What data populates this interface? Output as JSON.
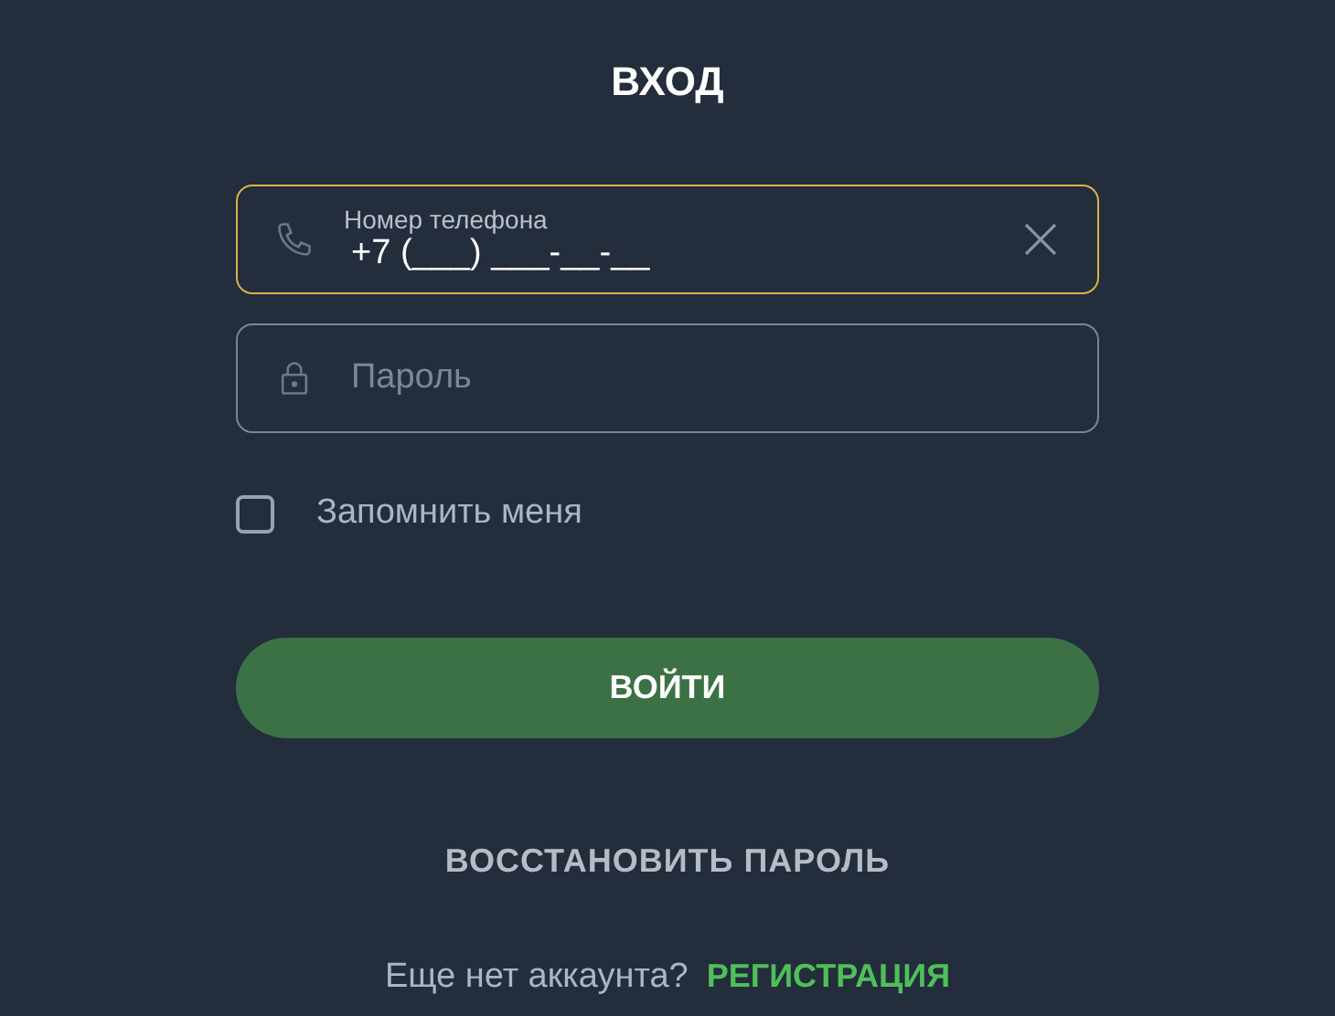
{
  "title": "ВХОД",
  "fields": [
    {
      "kind": "phone",
      "label": "Номер телефона",
      "value": "+7 (___) ___-__-__",
      "focused": true
    },
    {
      "kind": "password",
      "placeholder": "Пароль",
      "focused": false
    }
  ],
  "remember": {
    "label": "Запомнить меня",
    "checked": false
  },
  "submit": "ВОЙТИ",
  "restore": "ВОССТАНОВИТЬ ПАРОЛЬ",
  "footer": {
    "text": "Еще нет аккаунта?",
    "link": "РЕГИСТРАЦИЯ"
  }
}
